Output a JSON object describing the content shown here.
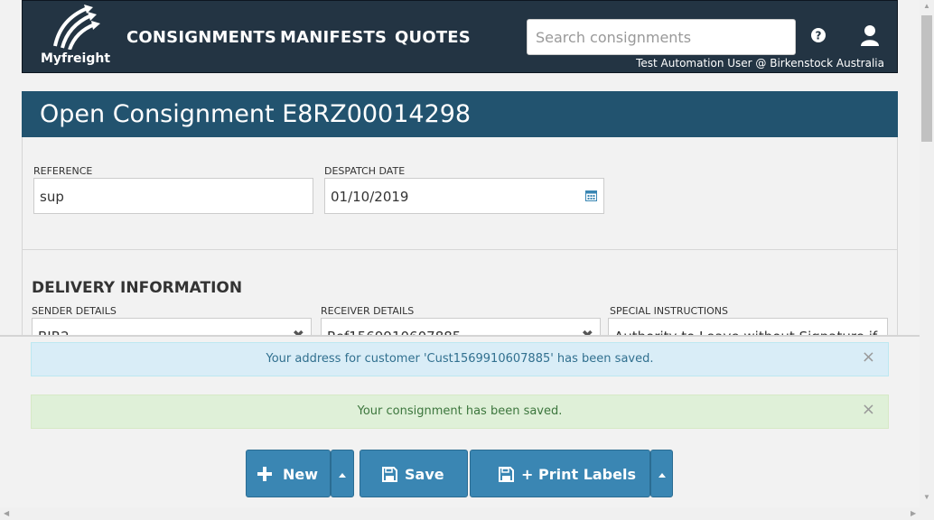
{
  "nav": {
    "brand": "Myfreight",
    "links": [
      "CONSIGNMENTS",
      "MANIFESTS",
      "QUOTES"
    ],
    "search_placeholder": "Search consignments",
    "user_line": "Test Automation User @ Birkenstock Australia",
    "help_icon": "question-circle-icon",
    "user_icon": "user-icon"
  },
  "panel": {
    "title": "Open Consignment E8RZ00014298",
    "reference_label": "REFERENCE",
    "reference_value": "sup",
    "despatch_label": "DESPATCH DATE",
    "despatch_value": "01/10/2019",
    "section_title": "DELIVERY INFORMATION",
    "sender_label": "SENDER DETAILS",
    "sender_value": "BIR2",
    "receiver_label": "RECEIVER DETAILS",
    "receiver_value": "Ref1569910607885",
    "instructions_label": "SPECIAL INSTRUCTIONS",
    "instructions_value": "Authority to Leave without Signature if"
  },
  "alerts": {
    "info": "Your address for customer 'Cust1569910607885' has been saved.",
    "success": "Your consignment has been saved.",
    "close": "×"
  },
  "buttons": {
    "new": "New",
    "save": "Save",
    "print": "+ Print Labels"
  },
  "colors": {
    "navbar": "#233443",
    "panel_header": "#22536f",
    "button": "#3a86b3"
  }
}
